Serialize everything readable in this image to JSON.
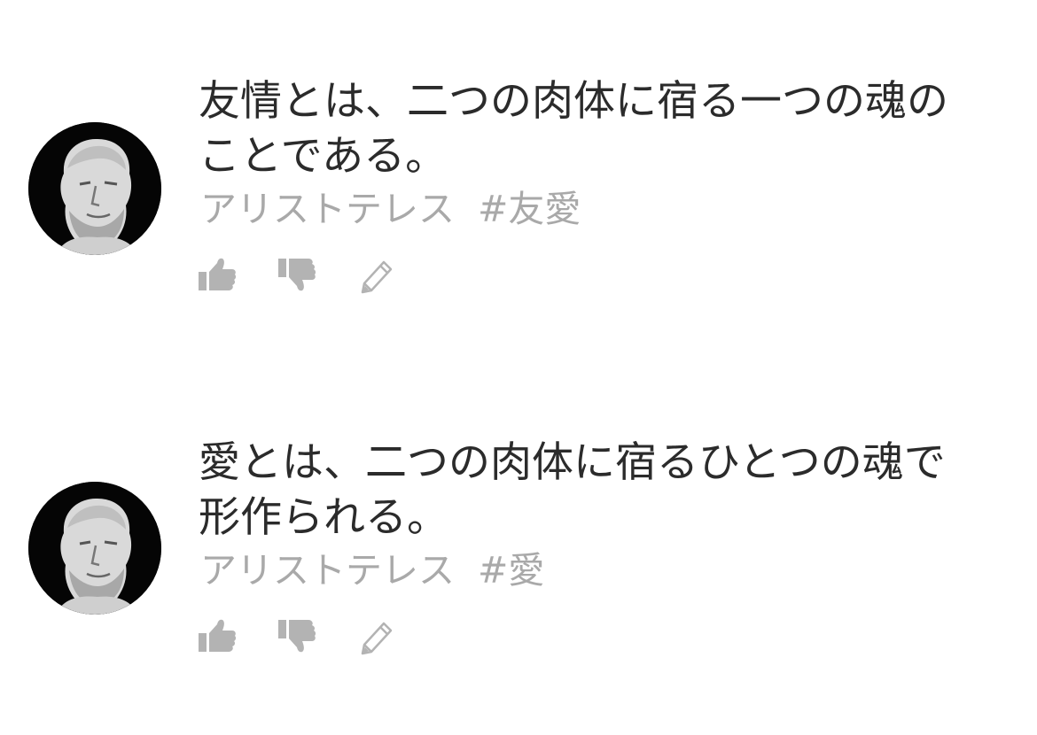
{
  "quotes": [
    {
      "text": "友情とは、二つの肉体に宿る一つの魂のことである。",
      "author": "アリストテレス",
      "hashtag": "#友愛",
      "avatar_icon": "aristotle-bust-avatar"
    },
    {
      "text": "愛とは、二つの肉体に宿るひとつの魂で形作られる。",
      "author": "アリストテレス",
      "hashtag": "#愛",
      "avatar_icon": "aristotle-bust-avatar"
    }
  ],
  "actions": {
    "like_icon": "thumbs-up-icon",
    "dislike_icon": "thumbs-down-icon",
    "edit_icon": "pencil-icon"
  },
  "colors": {
    "quote_text": "#2b2b2b",
    "meta_text": "#a9a9a9",
    "icon": "#b3b3b3",
    "background": "#ffffff"
  }
}
